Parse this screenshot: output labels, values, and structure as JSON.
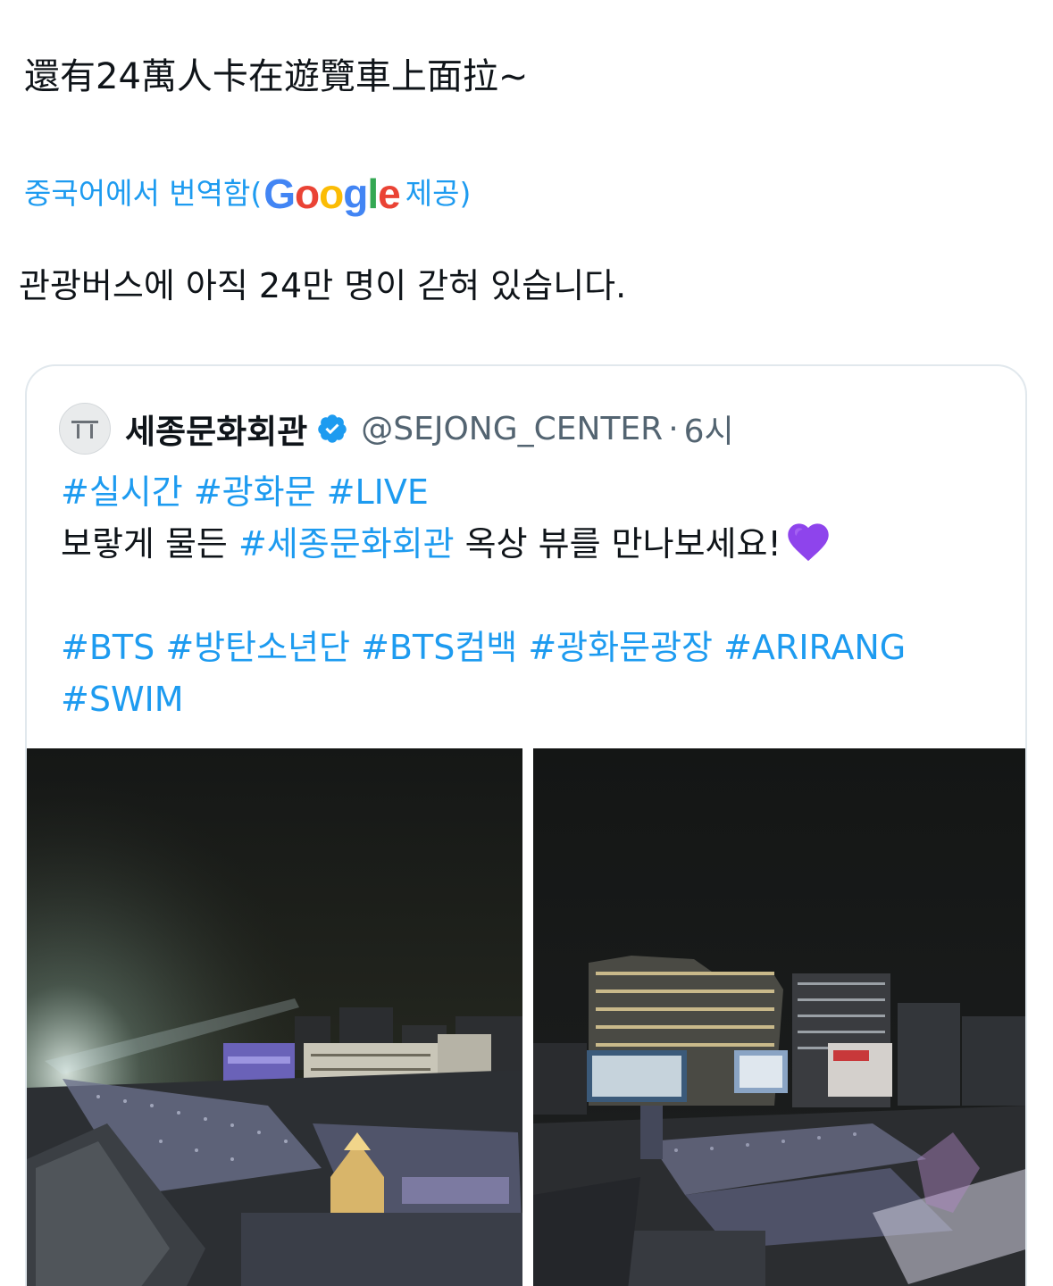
{
  "tweet": {
    "original_text": "還有24萬人卡在遊覽車上面拉~",
    "translation_prefix": "중국어에서 번역함(",
    "translation_provider": "Google",
    "translation_suffix": " 제공)",
    "translated_text": "관광버스에 아직 24만 명이 갇혀 있습니다."
  },
  "quoted_tweet": {
    "display_name": "세종문화회관",
    "handle": "@SEJONG_CENTER",
    "separator": "·",
    "time": "6시",
    "line1_tags": [
      "#실시간",
      "#광화문",
      "#LIVE"
    ],
    "line2_prefix": "보랗게 물든 ",
    "line2_tag": "#세종문화회관",
    "line2_suffix": " 옥상 뷰를 만나보세요!",
    "line3_tags": [
      "#BTS",
      "#방탄소년단",
      "#BTS컴백",
      "#광화문광장",
      "#ARIRANG"
    ],
    "line4_tags": [
      "#SWIM"
    ],
    "images": [
      {
        "icon": "night-crowd-photo-icon"
      },
      {
        "icon": "night-plaza-buildings-photo-icon"
      }
    ]
  },
  "colors": {
    "link": "#1d9bf0",
    "text": "#0f1419",
    "secondary": "#536471",
    "border": "#e1e8ed",
    "verified": "#1d9bf0",
    "heart": "#8e44ec"
  }
}
